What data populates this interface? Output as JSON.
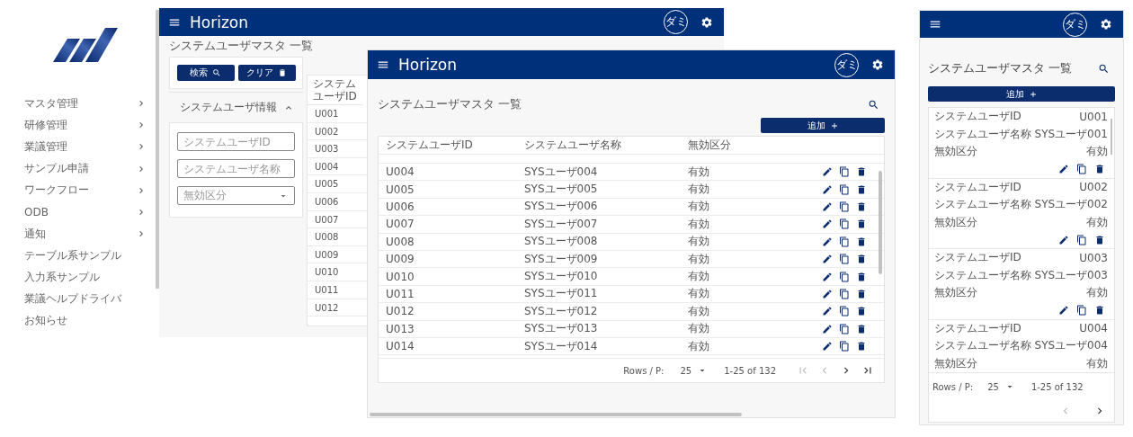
{
  "back_window": {
    "app_title": "Horizon",
    "avatar": "ダミ",
    "sidebar": [
      {
        "label": "マスタ管理",
        "expandable": true
      },
      {
        "label": "研修管理",
        "expandable": true
      },
      {
        "label": "業議管理",
        "expandable": true
      },
      {
        "label": "サンプル申請",
        "expandable": true
      },
      {
        "label": "ワークフロー",
        "expandable": true
      },
      {
        "label": "ODB",
        "expandable": true
      },
      {
        "label": "通知",
        "expandable": true
      },
      {
        "label": "テーブル系サンプル",
        "expandable": false
      },
      {
        "label": "入力系サンプル",
        "expandable": false
      },
      {
        "label": "業議ヘルプドライバ",
        "expandable": false
      },
      {
        "label": "お知らせ",
        "expandable": false
      }
    ],
    "page_title": "システムユーザマスタ 一覧",
    "buttons": [
      {
        "label": "検索",
        "kind": "search"
      },
      {
        "label": "クリア",
        "kind": "clear"
      }
    ],
    "section": {
      "title": "システムユーザ情報",
      "expanded": true
    },
    "fields": [
      {
        "kind": "text",
        "placeholder": "システムユーザID"
      },
      {
        "kind": "text",
        "placeholder": "システムユーザ名称"
      },
      {
        "kind": "select",
        "placeholder": "無効区分"
      }
    ],
    "table": {
      "columns": [
        "システムユーザID"
      ],
      "rows": [
        "U001",
        "U002",
        "U003",
        "U004",
        "U005",
        "U006",
        "U007",
        "U008",
        "U009",
        "U010",
        "U011",
        "U012"
      ]
    }
  },
  "front_window": {
    "app_title": "Horizon",
    "avatar": "ダミ",
    "page_title": "システムユーザマスタ 一覧",
    "add_button": "追加",
    "table": {
      "columns": [
        "システムユーザID",
        "システムユーザ名称",
        "無効区分"
      ],
      "rows": [
        {
          "id": "U004",
          "name": "SYSユーザ004",
          "status": "有効"
        },
        {
          "id": "U005",
          "name": "SYSユーザ005",
          "status": "有効"
        },
        {
          "id": "U006",
          "name": "SYSユーザ006",
          "status": "有効"
        },
        {
          "id": "U007",
          "name": "SYSユーザ007",
          "status": "有効"
        },
        {
          "id": "U008",
          "name": "SYSユーザ008",
          "status": "有効"
        },
        {
          "id": "U009",
          "name": "SYSユーザ009",
          "status": "有効"
        },
        {
          "id": "U010",
          "name": "SYSユーザ010",
          "status": "有効"
        },
        {
          "id": "U011",
          "name": "SYSユーザ011",
          "status": "有効"
        },
        {
          "id": "U012",
          "name": "SYSユーザ012",
          "status": "有効"
        },
        {
          "id": "U013",
          "name": "SYSユーザ013",
          "status": "有効"
        },
        {
          "id": "U014",
          "name": "SYSユーザ014",
          "status": "有効"
        }
      ]
    },
    "pagination": {
      "rows_label": "Rows / P:",
      "per_page": "25",
      "range": "1-25 of 132",
      "nav": [
        {
          "kind": "first",
          "disabled": true
        },
        {
          "kind": "prev",
          "disabled": true
        },
        {
          "kind": "next",
          "disabled": false
        },
        {
          "kind": "last",
          "disabled": false
        }
      ]
    }
  },
  "mobile_window": {
    "avatar": "ダミ",
    "page_title": "システムユーザマスタ 一覧",
    "add_button": "追加",
    "cards": [
      {
        "fields": [
          {
            "label": "システムユーザID",
            "value": "U001"
          },
          {
            "label": "システムユーザ名称",
            "value": "SYSユーザ001"
          },
          {
            "label": "無効区分",
            "value": "有効"
          }
        ],
        "actions": true
      },
      {
        "fields": [
          {
            "label": "システムユーザID",
            "value": "U002"
          },
          {
            "label": "システムユーザ名称",
            "value": "SYSユーザ002"
          },
          {
            "label": "無効区分",
            "value": "有効"
          }
        ],
        "actions": true
      },
      {
        "fields": [
          {
            "label": "システムユーザID",
            "value": "U003"
          },
          {
            "label": "システムユーザ名称",
            "value": "SYSユーザ003"
          },
          {
            "label": "無効区分",
            "value": "有効"
          }
        ],
        "actions": true
      },
      {
        "fields": [
          {
            "label": "システムユーザID",
            "value": "U004"
          },
          {
            "label": "システムユーザ名称",
            "value": "SYSユーザ004"
          },
          {
            "label": "無効区分",
            "value": "有効"
          }
        ],
        "actions": false
      }
    ],
    "pagination": {
      "rows_label": "Rows / P:",
      "per_page": "25",
      "range": "1-25 of 132",
      "nav": [
        {
          "kind": "prev",
          "disabled": true
        },
        {
          "kind": "next",
          "disabled": false
        }
      ]
    }
  }
}
